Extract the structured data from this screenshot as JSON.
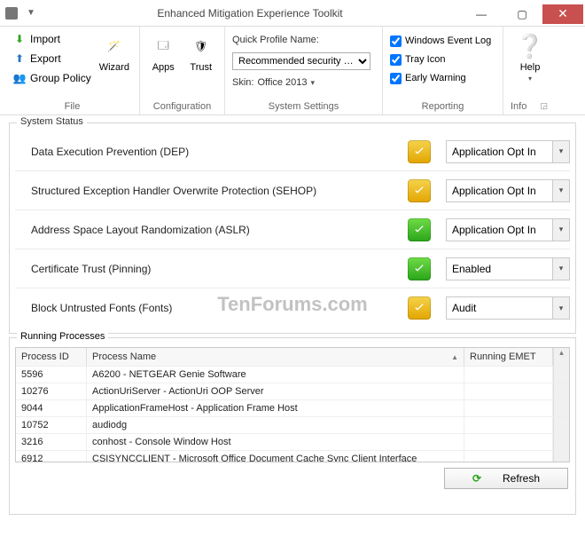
{
  "window": {
    "title": "Enhanced Mitigation Experience Toolkit"
  },
  "ribbon": {
    "file": {
      "label": "File",
      "import": "Import",
      "export": "Export",
      "group_policy": "Group Policy",
      "wizard": "Wizard"
    },
    "configuration": {
      "label": "Configuration",
      "apps": "Apps",
      "trust": "Trust"
    },
    "system_settings": {
      "label": "System Settings",
      "profile_label": "Quick Profile Name:",
      "profile_value": "Recommended security …",
      "skin_label": "Skin:",
      "skin_value": "Office 2013"
    },
    "reporting": {
      "label": "Reporting",
      "event_log": "Windows Event Log",
      "tray_icon": "Tray Icon",
      "early_warning": "Early Warning"
    },
    "info": {
      "label": "Info",
      "help": "Help"
    }
  },
  "system_status": {
    "legend": "System Status",
    "rows": [
      {
        "label": "Data Execution Prevention (DEP)",
        "state": "partial",
        "value": "Application Opt In"
      },
      {
        "label": "Structured Exception Handler Overwrite Protection (SEHOP)",
        "state": "partial",
        "value": "Application Opt In"
      },
      {
        "label": "Address Space Layout Randomization (ASLR)",
        "state": "on",
        "value": "Application Opt In"
      },
      {
        "label": "Certificate Trust (Pinning)",
        "state": "on",
        "value": "Enabled"
      },
      {
        "label": "Block Untrusted Fonts (Fonts)",
        "state": "partial",
        "value": "Audit"
      }
    ]
  },
  "processes": {
    "legend": "Running Processes",
    "columns": {
      "pid": "Process ID",
      "name": "Process Name",
      "emet": "Running EMET"
    },
    "rows": [
      {
        "pid": "5596",
        "name": "A6200 - NETGEAR Genie Software"
      },
      {
        "pid": "10276",
        "name": "ActionUriServer - ActionUri OOP Server"
      },
      {
        "pid": "9044",
        "name": "ApplicationFrameHost - Application Frame Host"
      },
      {
        "pid": "10752",
        "name": "audiodg"
      },
      {
        "pid": "3216",
        "name": "conhost - Console Window Host"
      },
      {
        "pid": "6912",
        "name": "CSISYNCCLIENT - Microsoft Office Document Cache Sync Client Interface"
      }
    ],
    "refresh": "Refresh"
  },
  "watermark": "TenForums.com"
}
